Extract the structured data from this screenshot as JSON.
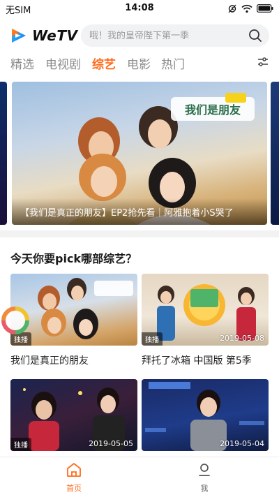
{
  "status_bar": {
    "carrier": "无SIM",
    "time": "14:08"
  },
  "header": {
    "logo_text": "WeTV",
    "search_placeholder": "哦！我的皇帝陛下第一季"
  },
  "tabs": [
    {
      "label": "精选",
      "active": false
    },
    {
      "label": "电视剧",
      "active": false
    },
    {
      "label": "综艺",
      "active": true
    },
    {
      "label": "电影",
      "active": false
    },
    {
      "label": "热门",
      "active": false
    }
  ],
  "banner": {
    "caption": "【我们是真正的朋友】EP2抢先看｜阿雅抱着小S哭了",
    "logo_text": "我们是朋友"
  },
  "section": {
    "title": "今天你要pick哪部综艺？"
  },
  "cards": [
    {
      "title": "我们是真正的朋友",
      "badge": "独播",
      "date": ""
    },
    {
      "title": "拜托了冰箱 中国版 第5季",
      "badge": "独播",
      "date": "2019-05-08"
    },
    {
      "title": "",
      "badge": "独播",
      "date": "2019-05-05"
    },
    {
      "title": "",
      "badge": "",
      "date": "2019-05-04"
    }
  ],
  "bottom_nav": [
    {
      "label": "首页",
      "active": true,
      "icon": "home-icon"
    },
    {
      "label": "我",
      "active": false,
      "icon": "profile-icon"
    }
  ],
  "colors": {
    "accent": "#ff6b1a",
    "brand_blue": "#2a8bf2"
  }
}
